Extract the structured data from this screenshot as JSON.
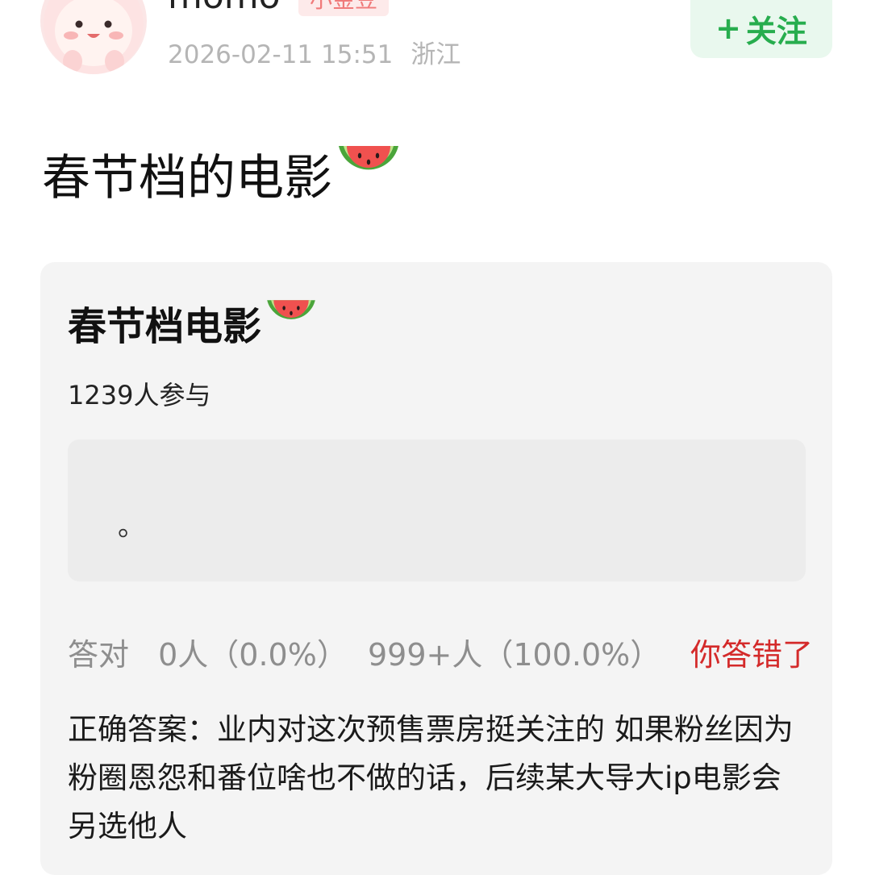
{
  "author": {
    "username": "momo",
    "badge": "小金豆",
    "timestamp": "2026-02-11 15:51",
    "location": "浙江"
  },
  "follow_button": {
    "plus": "+",
    "label": "关注"
  },
  "post": {
    "title": "春节档的电影",
    "title_emoji": "watermelon-emoji"
  },
  "quiz": {
    "title": "春节档电影",
    "participants": "1239人参与",
    "answer_option": "。",
    "correct_label": "答对",
    "correct_stat": "0人（0.0%）",
    "wrong_stat": "999+人（100.0%）",
    "your_result": "你答错了",
    "correct_answer": "正确答案：业内对这次预售票房挺关注的 如果粉丝因为粉圈恩怨和番位啥也不做的话，后续某大导大ip电影会另选他人"
  },
  "colors": {
    "follow_green": "#27ad4e",
    "follow_bg": "#e9f8ee",
    "wrong_red": "#d42a2a",
    "card_bg": "#f4f4f4",
    "badge_pink": "#f07a7a"
  }
}
